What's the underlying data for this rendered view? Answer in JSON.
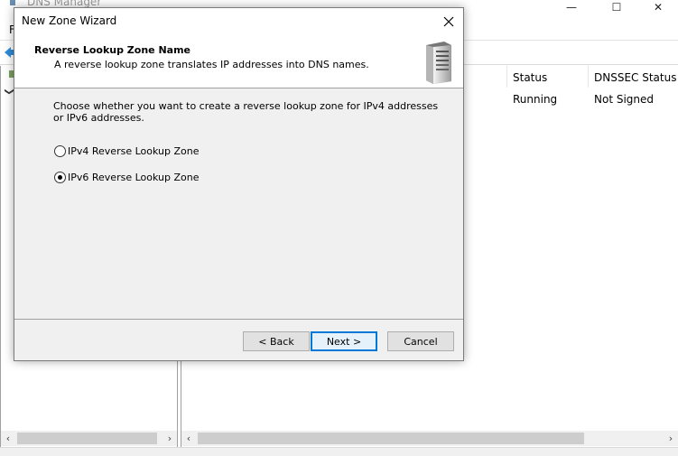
{
  "app": {
    "title": "DNS Manager",
    "menu_first": "F",
    "caption": {
      "minimize": "—",
      "maximize": "☐",
      "close": "✕"
    }
  },
  "list": {
    "columns": [
      "Status",
      "DNSSEC Status"
    ],
    "rows": [
      {
        "status": "Running",
        "dnssec": "Not Signed"
      }
    ]
  },
  "tree": {
    "expander": "❯"
  },
  "wizard": {
    "title": "New Zone Wizard",
    "close": "✕",
    "header_title": "Reverse Lookup Zone Name",
    "header_subtitle": "A reverse lookup zone translates IP addresses into DNS names.",
    "header_icon": "server-icon",
    "prompt": "Choose whether you want to create a reverse lookup zone for IPv4 addresses or IPv6 addresses.",
    "options": [
      {
        "label": "IPv4 Reverse Lookup Zone",
        "selected": false
      },
      {
        "label": "IPv6 Reverse Lookup Zone",
        "selected": true
      }
    ],
    "buttons": {
      "back": "< Back",
      "next": "Next >",
      "cancel": "Cancel"
    }
  },
  "scroll": {
    "left": "‹",
    "right": "›"
  },
  "colors": {
    "accent": "#0078d7",
    "dialog_bg": "#f0f0f0",
    "header_bg": "#ffffff"
  }
}
